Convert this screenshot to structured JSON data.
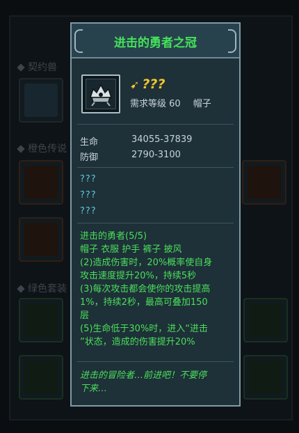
{
  "background": {
    "section_1": "契约兽",
    "section_2": "橙色传说",
    "section_3": "绿色套装"
  },
  "item": {
    "title": "进击的勇者之冠",
    "rank": "???",
    "required_level": "需求等级 60",
    "item_type": "帽子"
  },
  "stats": [
    {
      "label": "生命",
      "value": "34055-37839"
    },
    {
      "label": "防御",
      "value": "2790-3100"
    }
  ],
  "unknown_affixes": [
    "???",
    "???",
    "???"
  ],
  "set_bonus": {
    "lines": [
      "进击的勇者(5/5)",
      "帽子 衣服 护手 裤子 披风",
      "(2)造成伤害时，20%概率使自身",
      "攻击速度提升20%，持续5秒",
      "(3)每次攻击都会使你的攻击提高",
      "1%，持续2秒，最高可叠加150",
      "层",
      "(5)生命低于30%时，进入“进击",
      "”状态，造成的伤害提升20%"
    ]
  },
  "lore": {
    "line1": "进击的冒险者…前进吧！不要停",
    "line2": "下来…"
  },
  "colors": {
    "title_green": "#45e25b",
    "rank_gold": "#f0c62a",
    "unknown_cyan": "#5fc8d6",
    "panel_bg": "#1e3038",
    "panel_border": "#7f9aa6"
  }
}
